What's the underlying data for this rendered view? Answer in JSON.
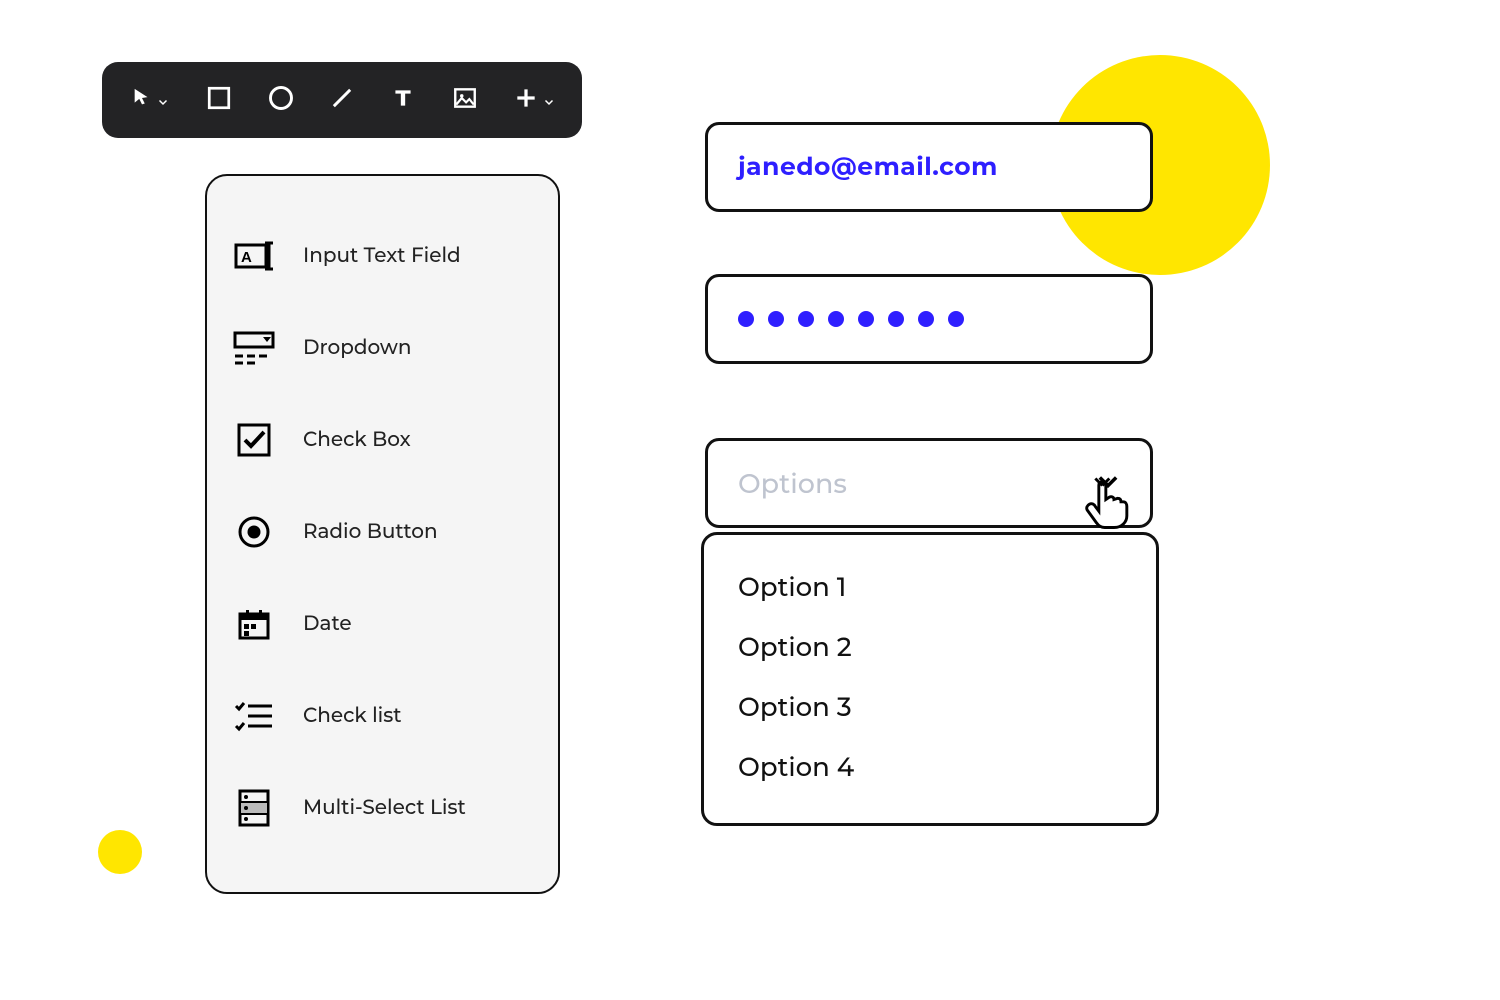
{
  "toolbar": {
    "tools": [
      "pointer",
      "rectangle",
      "circle",
      "line",
      "text",
      "image",
      "add"
    ]
  },
  "menu": {
    "items": [
      {
        "label": "Input Text Field"
      },
      {
        "label": "Dropdown"
      },
      {
        "label": "Check Box"
      },
      {
        "label": "Radio Button"
      },
      {
        "label": "Date"
      },
      {
        "label": "Check list"
      },
      {
        "label": "Multi-Select List"
      }
    ]
  },
  "form": {
    "email": "janedo@email.com",
    "password_dots": 8,
    "select_placeholder": "Options",
    "options": [
      "Option 1",
      "Option 2",
      "Option 3",
      "Option 4"
    ]
  },
  "colors": {
    "accent": "#2e1fff",
    "yellow": "#ffe600"
  }
}
